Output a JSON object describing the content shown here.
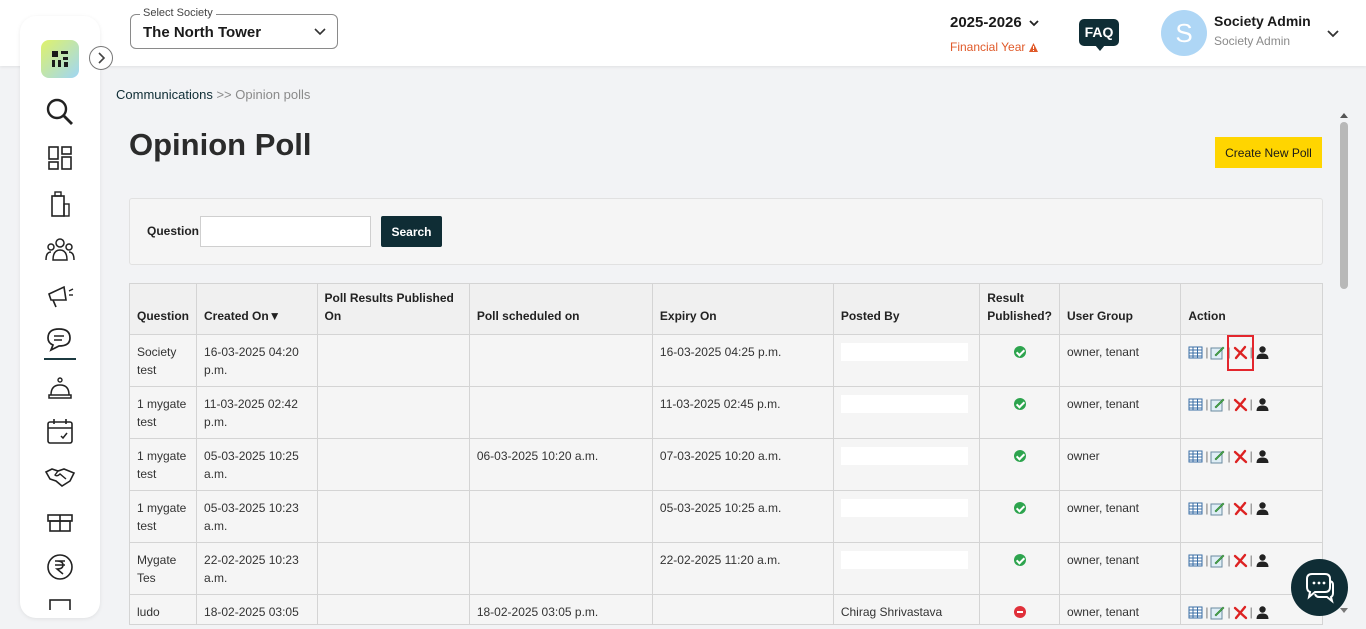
{
  "header": {
    "society_label": "Select Society",
    "society_value": "The North Tower",
    "financial_year": "2025-2026",
    "financial_year_label": "Financial Year",
    "faq_label": "FAQ",
    "avatar_letter": "S",
    "user_name": "Society Admin",
    "user_role": "Society Admin"
  },
  "sidebar": {
    "icons": [
      "search-icon",
      "dashboard-icon",
      "building-icon",
      "community-icon",
      "announcement-icon",
      "communications-icon",
      "services-icon",
      "calendar-icon",
      "handshake-icon",
      "gift-icon",
      "rupee-icon",
      "more-icon"
    ]
  },
  "breadcrumb": {
    "parent": "Communications",
    "separator": ">>",
    "current": "Opinion polls"
  },
  "page": {
    "title": "Opinion Poll",
    "create_button": "Create New Poll"
  },
  "search": {
    "label": "Question",
    "value": "",
    "button": "Search"
  },
  "table": {
    "headers": [
      "Question",
      "Created On▼",
      "Poll Results Published On",
      "Poll scheduled on",
      "Expiry On",
      "Posted By",
      "Result Published?",
      "User Group",
      "Action"
    ],
    "rows": [
      {
        "question": "Society test",
        "created_on": "16-03-2025 04:20 p.m.",
        "published_on": "",
        "scheduled_on": "",
        "expiry_on": "16-03-2025 04:25 p.m.",
        "posted_by": "",
        "result_published": "yes",
        "user_group": "owner, tenant"
      },
      {
        "question": "1 mygate test",
        "created_on": "11-03-2025 02:42 p.m.",
        "published_on": "",
        "scheduled_on": "",
        "expiry_on": "11-03-2025 02:45 p.m.",
        "posted_by": "",
        "result_published": "yes",
        "user_group": "owner, tenant"
      },
      {
        "question": "1 mygate test",
        "created_on": "05-03-2025 10:25 a.m.",
        "published_on": "",
        "scheduled_on": "06-03-2025 10:20 a.m.",
        "expiry_on": "07-03-2025 10:20 a.m.",
        "posted_by": "",
        "result_published": "yes",
        "user_group": "owner"
      },
      {
        "question": "1 mygate test",
        "created_on": "05-03-2025 10:23 a.m.",
        "published_on": "",
        "scheduled_on": "",
        "expiry_on": "05-03-2025 10:25 a.m.",
        "posted_by": "",
        "result_published": "yes",
        "user_group": "owner, tenant"
      },
      {
        "question": "Mygate Tes",
        "created_on": "22-02-2025 10:23 a.m.",
        "published_on": "",
        "scheduled_on": "",
        "expiry_on": "22-02-2025 11:20 a.m.",
        "posted_by": "",
        "result_published": "yes",
        "user_group": "owner, tenant"
      },
      {
        "question": "ludo",
        "created_on": "18-02-2025 03:05",
        "published_on": "",
        "scheduled_on": "18-02-2025 03:05 p.m.",
        "expiry_on": "",
        "posted_by": "Chirag Shrivastava",
        "result_published": "no",
        "user_group": "owner, tenant"
      }
    ],
    "action_icons": [
      "view-results-icon",
      "edit-icon",
      "delete-icon",
      "user-icon"
    ]
  },
  "colors": {
    "brand_dark": "#0f2d35",
    "accent_yellow": "#ffd500",
    "warning_orange": "#e05a2a",
    "success_green": "#2da44e",
    "danger_red": "#e0303a"
  }
}
